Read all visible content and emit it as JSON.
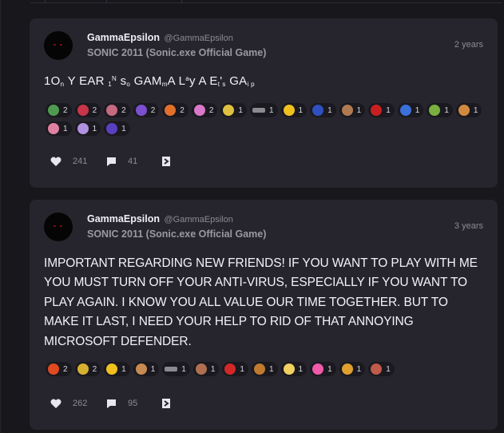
{
  "posts": [
    {
      "author": "GammaEpsilon",
      "handle": "@GammaEpsilon",
      "game": "SONIC 2011 (Sonic.exe Official Game)",
      "time": "2 years",
      "text": "1On YEAR 1N so GAMmA Lay A Et's GAi p",
      "reactions": [
        {
          "icon": "green-dragon-icon",
          "color": "#4f9a4f",
          "count": "2"
        },
        {
          "icon": "red-crab-icon",
          "color": "#c8344a",
          "count": "2"
        },
        {
          "icon": "pink-creature-icon",
          "color": "#c56a80",
          "count": "2"
        },
        {
          "icon": "purple-shadow-icon",
          "color": "#7b4fd0",
          "count": "2"
        },
        {
          "icon": "fire-crest-icon",
          "color": "#e0702a",
          "count": "2"
        },
        {
          "icon": "pink-crystal-icon",
          "color": "#d978c8",
          "count": "2"
        },
        {
          "icon": "yellow-face-icon",
          "color": "#e0c040",
          "count": "1"
        },
        {
          "icon": "sunglasses-icon",
          "color": "#8a8a90",
          "count": "1"
        },
        {
          "icon": "star-icon",
          "color": "#f0c020",
          "count": "1"
        },
        {
          "icon": "blue-hedgehog-icon",
          "color": "#3050c0",
          "count": "1"
        },
        {
          "icon": "brown-animal-icon",
          "color": "#b07a50",
          "count": "1"
        },
        {
          "icon": "red-helmet-icon",
          "color": "#c82020",
          "count": "1"
        },
        {
          "icon": "blue-speed-icon",
          "color": "#3a70d8",
          "count": "1"
        },
        {
          "icon": "green-leaf-icon",
          "color": "#7ab040",
          "count": "1"
        },
        {
          "icon": "donut-icon",
          "color": "#d08a40",
          "count": "1"
        },
        {
          "icon": "pink-pig-icon",
          "color": "#e080a0",
          "count": "1"
        },
        {
          "icon": "lavender-spirit-icon",
          "color": "#b090e0",
          "count": "1"
        },
        {
          "icon": "purple-flame-icon",
          "color": "#5a40c0",
          "count": "1"
        }
      ],
      "likes": "241",
      "comments": "41"
    },
    {
      "author": "GammaEpsilon",
      "handle": "@GammaEpsilon",
      "game": "SONIC 2011 (Sonic.exe Official Game)",
      "time": "3 years",
      "text": "IMPORTANT REGARDING NEW FRIENDS! IF YOU WANT TO PLAY WITH ME YOU MUST TURN OFF YOUR ANTI-VIRUS, ESPECIALLY IF YOU WANT TO PLAY AGAIN. I KNOW YOU ALL VALUE OUR TIME TOGETHER. BUT TO MAKE IT LAST, I NEED YOUR HELP TO RID OF THAT ANNOYING MICROSOFT DEFENDER.",
      "reactions": [
        {
          "icon": "fire-icon",
          "color": "#e04a20",
          "count": "2"
        },
        {
          "icon": "golden-face-icon",
          "color": "#d8b030",
          "count": "2"
        },
        {
          "icon": "yellow-f-icon",
          "color": "#f0c020",
          "count": "1"
        },
        {
          "icon": "cookie-icon",
          "color": "#c88a50",
          "count": "1"
        },
        {
          "icon": "sunglasses-icon",
          "color": "#8a8a90",
          "count": "1"
        },
        {
          "icon": "drink-cup-icon",
          "color": "#b07050",
          "count": "1"
        },
        {
          "icon": "red-mushroom-icon",
          "color": "#d02828",
          "count": "1"
        },
        {
          "icon": "burger-icon",
          "color": "#c07a30",
          "count": "1"
        },
        {
          "icon": "yellow-heart-icon",
          "color": "#f0d060",
          "count": "1"
        },
        {
          "icon": "pink-heart-icon",
          "color": "#f05aa8",
          "count": "1"
        },
        {
          "icon": "lightning-icon",
          "color": "#e0a030",
          "count": "1"
        },
        {
          "icon": "screaming-face-icon",
          "color": "#c05a4a",
          "count": "1"
        }
      ],
      "likes": "262",
      "comments": "95"
    }
  ]
}
